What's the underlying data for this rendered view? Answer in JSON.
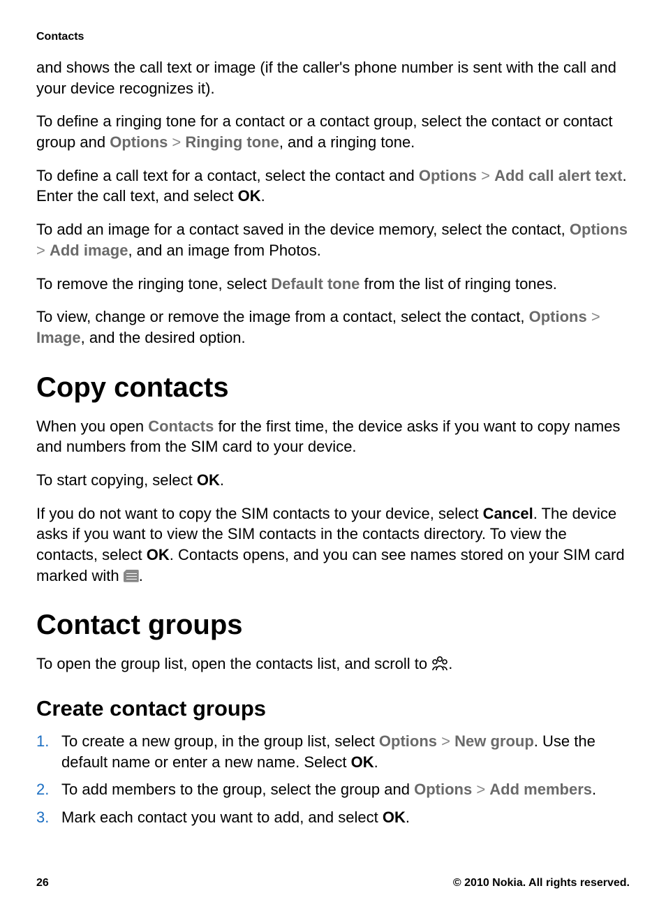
{
  "section_label": "Contacts",
  "p1": "and shows the call text or image (if the caller's phone number is sent with the call and your device recognizes it).",
  "p2a": "To define a ringing tone for a contact or a contact group, select the contact or contact group and ",
  "p2_options": "Options",
  "p2_sep": " > ",
  "p2_ringing": "Ringing tone",
  "p2b": ", and a ringing tone.",
  "p3a": "To define a call text for a contact, select the contact and ",
  "p3_options": "Options",
  "p3_sep": " > ",
  "p3_add": "Add call alert text",
  "p3b": ". Enter the call text, and select ",
  "p3_ok": "OK",
  "p3c": ".",
  "p4a": "To add an image for a contact saved in the device memory, select the contact, ",
  "p4_options": "Options",
  "p4_sep": " > ",
  "p4_add": "Add image",
  "p4b": ", and an image from Photos.",
  "p5a": "To remove the ringing tone, select ",
  "p5_default": "Default tone",
  "p5b": " from the list of ringing tones.",
  "p6a": "To view, change or remove the image from a contact, select the contact, ",
  "p6_options": "Options",
  "p6_sep": " > ",
  "p6_image": "Image",
  "p6b": ", and the desired option.",
  "h1_copy": "Copy contacts",
  "copy_p1a": "When you open ",
  "copy_p1_contacts": "Contacts",
  "copy_p1b": " for the first time, the device asks if you want to copy names and numbers from the SIM card to your device.",
  "copy_p2a": "To start copying, select ",
  "copy_p2_ok": "OK",
  "copy_p2b": ".",
  "copy_p3a": "If you do not want to copy the SIM contacts to your device, select ",
  "copy_p3_cancel": "Cancel",
  "copy_p3b": ". The device asks if you want to view the SIM contacts in the contacts directory. To view the contacts, select ",
  "copy_p3_ok": "OK",
  "copy_p3c": ". Contacts opens, and you can see names stored on your SIM card marked with ",
  "copy_p3d": ".",
  "h1_groups": "Contact groups",
  "groups_p1a": "To open the group list, open the contacts list, and scroll to ",
  "groups_p1b": ".",
  "h2_create": "Create contact groups",
  "li1a": "To create a new group, in the group list, select ",
  "li1_options": "Options",
  "li1_sep": " > ",
  "li1_new": "New group",
  "li1b": ". Use the default name or enter a new name. Select ",
  "li1_ok": "OK",
  "li1c": ".",
  "li2a": "To add members to the group, select the group and ",
  "li2_options": "Options",
  "li2_sep": " > ",
  "li2_add": "Add members",
  "li2b": ".",
  "li3a": "Mark each contact you want to add, and select ",
  "li3_ok": "OK",
  "li3b": ".",
  "footer_page": "26",
  "footer_copyright": "© 2010 Nokia. All rights reserved."
}
